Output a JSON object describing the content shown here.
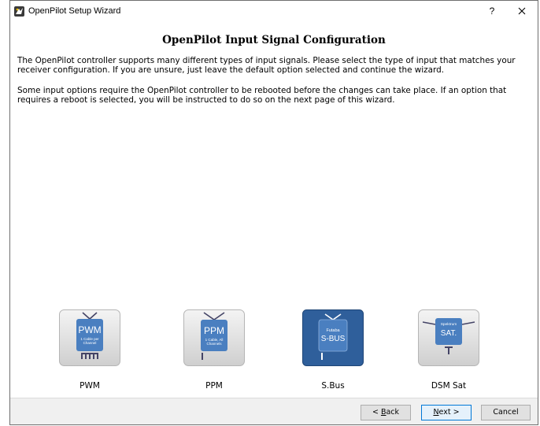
{
  "window": {
    "title": "OpenPilot Setup Wizard",
    "help_label": "?",
    "close_icon": "close-icon"
  },
  "page": {
    "heading": "OpenPilot Input Signal Configuration",
    "paragraph1": "The OpenPilot controller supports many different types of input signals. Please select the type of input that matches your receiver configuration. If you are unsure, just leave the default option selected and continue the wizard.",
    "paragraph2": "Some input options require the OpenPilot controller to be rebooted before the changes can take place. If an option that requires a reboot is selected, you will be instructed to do so on the next page of this wizard."
  },
  "options": [
    {
      "label": "PWM",
      "icon_title": "PWM",
      "icon_sub1": "1 Cable per",
      "icon_sub2": "Channel",
      "selected": false
    },
    {
      "label": "PPM",
      "icon_title": "PPM",
      "icon_sub1": "1 Cable, All",
      "icon_sub2": "Channels",
      "selected": false
    },
    {
      "label": "S.Bus",
      "icon_top": "Futaba",
      "icon_title": "S-BUS",
      "selected": true
    },
    {
      "label": "DSM Sat",
      "icon_top": "Spektrum",
      "icon_title": "SAT.",
      "selected": false
    }
  ],
  "buttons": {
    "back_mnemonic": "B",
    "back_rest": "ack",
    "back_prefix": "< ",
    "next_mnemonic": "N",
    "next_rest": "ext >",
    "cancel": "Cancel"
  },
  "colors": {
    "accent": "#0078d7",
    "selected_tile": "#2f5f9b",
    "screen_blue": "#4a7fc0"
  }
}
